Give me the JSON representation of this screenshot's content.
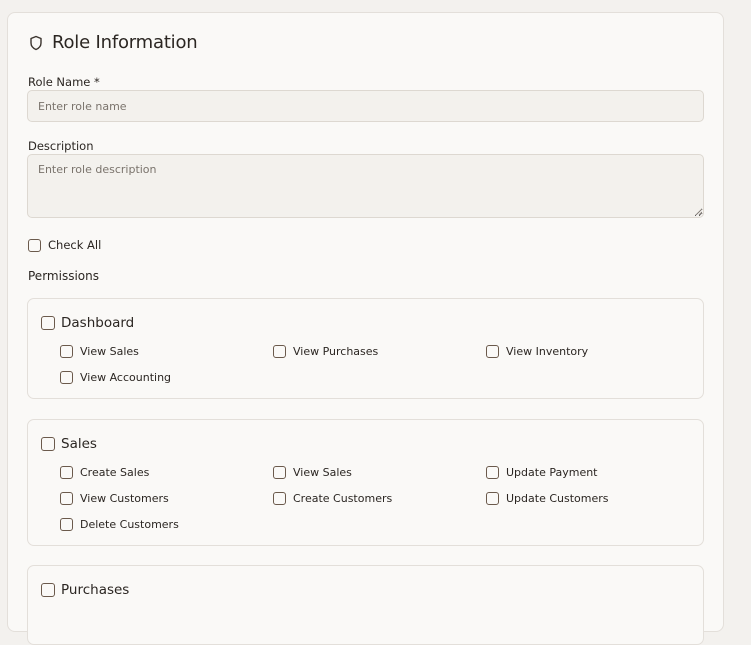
{
  "header": {
    "title": "Role Information",
    "icon": "shield-icon"
  },
  "form": {
    "role_name_label": "Role Name *",
    "role_name_placeholder": "Enter role name",
    "role_name_value": "",
    "description_label": "Description",
    "description_placeholder": "Enter role description",
    "description_value": ""
  },
  "check_all": {
    "label": "Check All",
    "checked": false
  },
  "permissions": {
    "heading": "Permissions",
    "groups": [
      {
        "title": "Dashboard",
        "items": [
          "View Sales",
          "View Purchases",
          "View Inventory",
          "View Accounting"
        ]
      },
      {
        "title": "Sales",
        "items": [
          "Create Sales",
          "View Sales",
          "Update Payment",
          "View Customers",
          "Create Customers",
          "Update Customers",
          "Delete Customers"
        ]
      },
      {
        "title": "Purchases",
        "items": []
      }
    ]
  },
  "colors": {
    "card": "#faf9f7",
    "border": "#e3dfda",
    "input_bg": "#f3f1ed",
    "checkbox_border": "#6b5a4c"
  }
}
